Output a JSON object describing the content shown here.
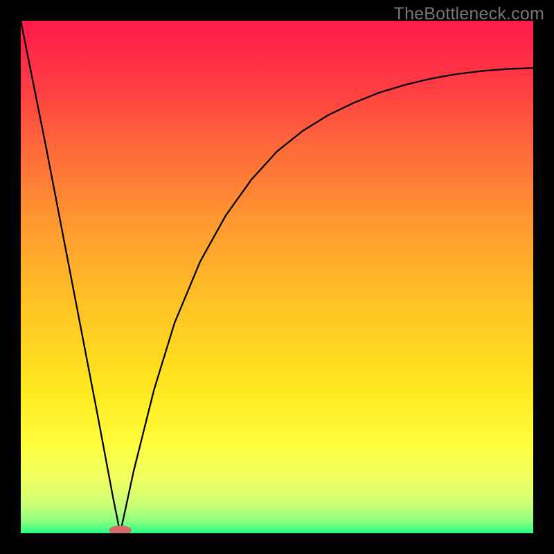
{
  "watermark": "TheBottleneck.com",
  "gradient": {
    "stops": [
      {
        "offset": 0.0,
        "color": "#ff1a4a"
      },
      {
        "offset": 0.12,
        "color": "#ff3a44"
      },
      {
        "offset": 0.25,
        "color": "#ff6a3a"
      },
      {
        "offset": 0.4,
        "color": "#ff9a30"
      },
      {
        "offset": 0.55,
        "color": "#ffc225"
      },
      {
        "offset": 0.72,
        "color": "#ffe81f"
      },
      {
        "offset": 0.82,
        "color": "#fffd3a"
      },
      {
        "offset": 0.9,
        "color": "#ecff63"
      },
      {
        "offset": 0.945,
        "color": "#c9ff77"
      },
      {
        "offset": 0.975,
        "color": "#8fff82"
      },
      {
        "offset": 1.0,
        "color": "#29ff83"
      }
    ]
  },
  "chart_data": {
    "type": "line",
    "title": "",
    "xlabel": "",
    "ylabel": "",
    "xlim": [
      0,
      100
    ],
    "ylim": [
      0,
      100
    ],
    "marker": {
      "x": 19.4,
      "y": 0.6,
      "color": "#d46a6a",
      "rx": 2.2,
      "ry": 0.9
    },
    "series": [
      {
        "name": "curve",
        "x": [
          0,
          5,
          10,
          15,
          18,
          19.4,
          22,
          26,
          30,
          35,
          40,
          45,
          50,
          55,
          60,
          65,
          70,
          75,
          80,
          85,
          90,
          95,
          100
        ],
        "y": [
          100,
          75,
          49,
          23,
          7,
          0,
          12,
          28,
          41,
          53,
          62,
          69,
          74.5,
          78.5,
          81.6,
          84,
          86,
          87.5,
          88.7,
          89.6,
          90.2,
          90.6,
          90.8
        ]
      }
    ]
  }
}
